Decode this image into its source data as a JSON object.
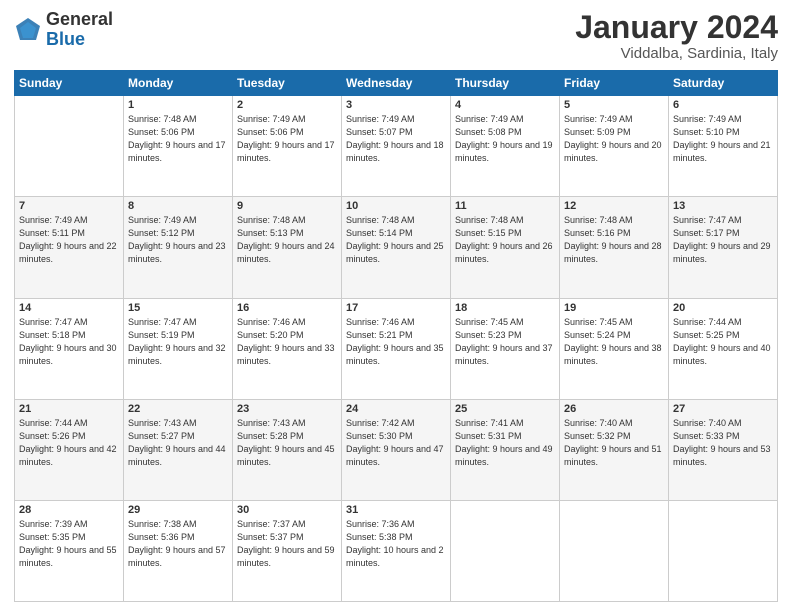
{
  "header": {
    "logo_general": "General",
    "logo_blue": "Blue",
    "title": "January 2024",
    "subtitle": "Viddalba, Sardinia, Italy"
  },
  "days_of_week": [
    "Sunday",
    "Monday",
    "Tuesday",
    "Wednesday",
    "Thursday",
    "Friday",
    "Saturday"
  ],
  "weeks": [
    [
      {
        "day": "",
        "sunrise": "",
        "sunset": "",
        "daylight": ""
      },
      {
        "day": "1",
        "sunrise": "Sunrise: 7:48 AM",
        "sunset": "Sunset: 5:06 PM",
        "daylight": "Daylight: 9 hours and 17 minutes."
      },
      {
        "day": "2",
        "sunrise": "Sunrise: 7:49 AM",
        "sunset": "Sunset: 5:06 PM",
        "daylight": "Daylight: 9 hours and 17 minutes."
      },
      {
        "day": "3",
        "sunrise": "Sunrise: 7:49 AM",
        "sunset": "Sunset: 5:07 PM",
        "daylight": "Daylight: 9 hours and 18 minutes."
      },
      {
        "day": "4",
        "sunrise": "Sunrise: 7:49 AM",
        "sunset": "Sunset: 5:08 PM",
        "daylight": "Daylight: 9 hours and 19 minutes."
      },
      {
        "day": "5",
        "sunrise": "Sunrise: 7:49 AM",
        "sunset": "Sunset: 5:09 PM",
        "daylight": "Daylight: 9 hours and 20 minutes."
      },
      {
        "day": "6",
        "sunrise": "Sunrise: 7:49 AM",
        "sunset": "Sunset: 5:10 PM",
        "daylight": "Daylight: 9 hours and 21 minutes."
      }
    ],
    [
      {
        "day": "7",
        "sunrise": "Sunrise: 7:49 AM",
        "sunset": "Sunset: 5:11 PM",
        "daylight": "Daylight: 9 hours and 22 minutes."
      },
      {
        "day": "8",
        "sunrise": "Sunrise: 7:49 AM",
        "sunset": "Sunset: 5:12 PM",
        "daylight": "Daylight: 9 hours and 23 minutes."
      },
      {
        "day": "9",
        "sunrise": "Sunrise: 7:48 AM",
        "sunset": "Sunset: 5:13 PM",
        "daylight": "Daylight: 9 hours and 24 minutes."
      },
      {
        "day": "10",
        "sunrise": "Sunrise: 7:48 AM",
        "sunset": "Sunset: 5:14 PM",
        "daylight": "Daylight: 9 hours and 25 minutes."
      },
      {
        "day": "11",
        "sunrise": "Sunrise: 7:48 AM",
        "sunset": "Sunset: 5:15 PM",
        "daylight": "Daylight: 9 hours and 26 minutes."
      },
      {
        "day": "12",
        "sunrise": "Sunrise: 7:48 AM",
        "sunset": "Sunset: 5:16 PM",
        "daylight": "Daylight: 9 hours and 28 minutes."
      },
      {
        "day": "13",
        "sunrise": "Sunrise: 7:47 AM",
        "sunset": "Sunset: 5:17 PM",
        "daylight": "Daylight: 9 hours and 29 minutes."
      }
    ],
    [
      {
        "day": "14",
        "sunrise": "Sunrise: 7:47 AM",
        "sunset": "Sunset: 5:18 PM",
        "daylight": "Daylight: 9 hours and 30 minutes."
      },
      {
        "day": "15",
        "sunrise": "Sunrise: 7:47 AM",
        "sunset": "Sunset: 5:19 PM",
        "daylight": "Daylight: 9 hours and 32 minutes."
      },
      {
        "day": "16",
        "sunrise": "Sunrise: 7:46 AM",
        "sunset": "Sunset: 5:20 PM",
        "daylight": "Daylight: 9 hours and 33 minutes."
      },
      {
        "day": "17",
        "sunrise": "Sunrise: 7:46 AM",
        "sunset": "Sunset: 5:21 PM",
        "daylight": "Daylight: 9 hours and 35 minutes."
      },
      {
        "day": "18",
        "sunrise": "Sunrise: 7:45 AM",
        "sunset": "Sunset: 5:23 PM",
        "daylight": "Daylight: 9 hours and 37 minutes."
      },
      {
        "day": "19",
        "sunrise": "Sunrise: 7:45 AM",
        "sunset": "Sunset: 5:24 PM",
        "daylight": "Daylight: 9 hours and 38 minutes."
      },
      {
        "day": "20",
        "sunrise": "Sunrise: 7:44 AM",
        "sunset": "Sunset: 5:25 PM",
        "daylight": "Daylight: 9 hours and 40 minutes."
      }
    ],
    [
      {
        "day": "21",
        "sunrise": "Sunrise: 7:44 AM",
        "sunset": "Sunset: 5:26 PM",
        "daylight": "Daylight: 9 hours and 42 minutes."
      },
      {
        "day": "22",
        "sunrise": "Sunrise: 7:43 AM",
        "sunset": "Sunset: 5:27 PM",
        "daylight": "Daylight: 9 hours and 44 minutes."
      },
      {
        "day": "23",
        "sunrise": "Sunrise: 7:43 AM",
        "sunset": "Sunset: 5:28 PM",
        "daylight": "Daylight: 9 hours and 45 minutes."
      },
      {
        "day": "24",
        "sunrise": "Sunrise: 7:42 AM",
        "sunset": "Sunset: 5:30 PM",
        "daylight": "Daylight: 9 hours and 47 minutes."
      },
      {
        "day": "25",
        "sunrise": "Sunrise: 7:41 AM",
        "sunset": "Sunset: 5:31 PM",
        "daylight": "Daylight: 9 hours and 49 minutes."
      },
      {
        "day": "26",
        "sunrise": "Sunrise: 7:40 AM",
        "sunset": "Sunset: 5:32 PM",
        "daylight": "Daylight: 9 hours and 51 minutes."
      },
      {
        "day": "27",
        "sunrise": "Sunrise: 7:40 AM",
        "sunset": "Sunset: 5:33 PM",
        "daylight": "Daylight: 9 hours and 53 minutes."
      }
    ],
    [
      {
        "day": "28",
        "sunrise": "Sunrise: 7:39 AM",
        "sunset": "Sunset: 5:35 PM",
        "daylight": "Daylight: 9 hours and 55 minutes."
      },
      {
        "day": "29",
        "sunrise": "Sunrise: 7:38 AM",
        "sunset": "Sunset: 5:36 PM",
        "daylight": "Daylight: 9 hours and 57 minutes."
      },
      {
        "day": "30",
        "sunrise": "Sunrise: 7:37 AM",
        "sunset": "Sunset: 5:37 PM",
        "daylight": "Daylight: 9 hours and 59 minutes."
      },
      {
        "day": "31",
        "sunrise": "Sunrise: 7:36 AM",
        "sunset": "Sunset: 5:38 PM",
        "daylight": "Daylight: 10 hours and 2 minutes."
      },
      {
        "day": "",
        "sunrise": "",
        "sunset": "",
        "daylight": ""
      },
      {
        "day": "",
        "sunrise": "",
        "sunset": "",
        "daylight": ""
      },
      {
        "day": "",
        "sunrise": "",
        "sunset": "",
        "daylight": ""
      }
    ]
  ]
}
